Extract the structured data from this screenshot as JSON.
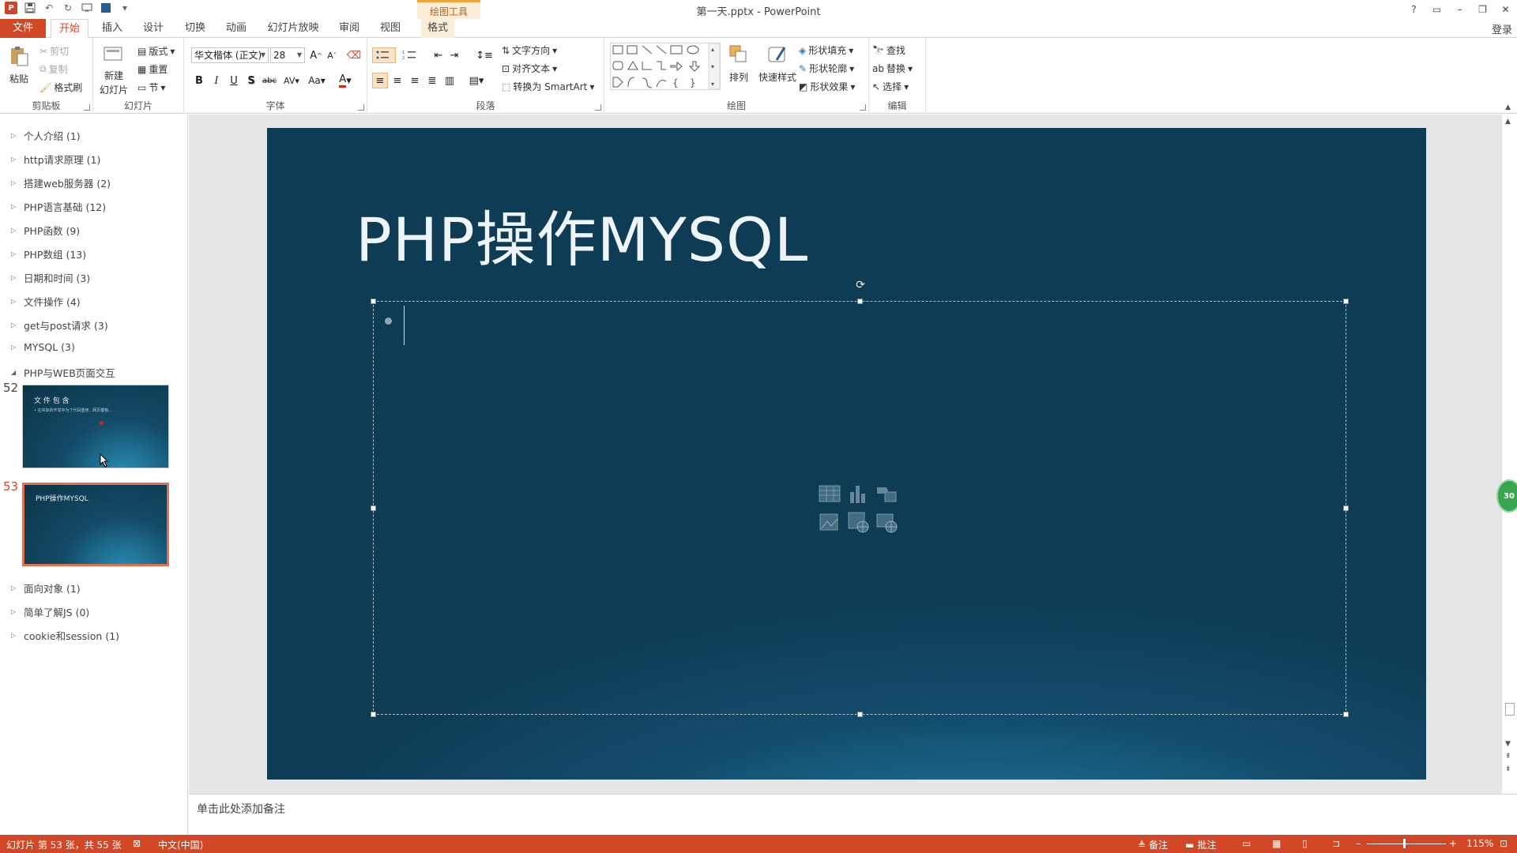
{
  "window": {
    "title": "第一天.pptx - PowerPoint",
    "contextual_group": "绘图工具",
    "login": "登录"
  },
  "tabs": [
    {
      "label": "文件"
    },
    {
      "label": "开始"
    },
    {
      "label": "插入"
    },
    {
      "label": "设计"
    },
    {
      "label": "切换"
    },
    {
      "label": "动画"
    },
    {
      "label": "幻灯片放映"
    },
    {
      "label": "审阅"
    },
    {
      "label": "视图"
    },
    {
      "label": "格式"
    }
  ],
  "ribbon": {
    "clipboard": {
      "label": "剪贴板",
      "paste": "粘贴",
      "cut": "剪切",
      "copy": "复制",
      "format_painter": "格式刷"
    },
    "slides": {
      "label": "幻灯片",
      "new_slide": "新建",
      "new_slide_line2": "幻灯片",
      "layout": "版式",
      "reset": "重置",
      "section": "节"
    },
    "font": {
      "label": "字体",
      "font_name": "华文楷体 (正文)",
      "font_size": "28",
      "bold": "B",
      "italic": "I",
      "underline": "U",
      "shadow": "S",
      "strike": "abc",
      "spacing": "AV",
      "case": "Aa",
      "color_a": "A"
    },
    "paragraph": {
      "label": "段落",
      "text_direction": "文字方向",
      "align_text": "对齐文本",
      "smartart": "转换为 SmartArt"
    },
    "drawing": {
      "label": "绘图",
      "arrange": "排列",
      "quick_styles": "快速样式",
      "shape_fill": "形状填充",
      "shape_outline": "形状轮廓",
      "shape_effects": "形状效果"
    },
    "editing": {
      "label": "编辑",
      "find": "查找",
      "replace": "替换",
      "select": "选择"
    }
  },
  "sections_top": [
    {
      "label": "个人介绍 (1)"
    },
    {
      "label": "http请求原理 (1)"
    },
    {
      "label": "搭建web服务器 (2)"
    },
    {
      "label": "PHP语言基础 (12)"
    },
    {
      "label": "PHP函数 (9)"
    },
    {
      "label": "PHP数组 (13)"
    },
    {
      "label": "日期和时间 (3)"
    },
    {
      "label": "文件操作 (4)"
    },
    {
      "label": "get与post请求 (3)"
    },
    {
      "label": "MYSQL (3)"
    },
    {
      "label": "PHP与WEB页面交互"
    }
  ],
  "thumbnails": [
    {
      "number": "52",
      "title": "文 件 包 含",
      "line": "• 在实际的开发中为了代码重用...网页模板..."
    },
    {
      "number": "53",
      "title": "PHP操作MYSQL",
      "line": ""
    }
  ],
  "sections_bottom": [
    {
      "label": "面向对象 (1)"
    },
    {
      "label": "简单了解JS (0)"
    },
    {
      "label": "cookie和session (1)"
    }
  ],
  "slide": {
    "title": "PHP操作MYSQL"
  },
  "notes": {
    "placeholder": "单击此处添加备注"
  },
  "status": {
    "slide_info": "幻灯片 第 53 张，共 55 张",
    "language": "中文(中国)",
    "notes": "备注",
    "comments": "批注",
    "zoom": "115%"
  },
  "badge": {
    "text": "30"
  },
  "colors": {
    "accent": "#d24726",
    "slide_dark": "#0e3c55",
    "slide_light": "#2b95c2"
  }
}
